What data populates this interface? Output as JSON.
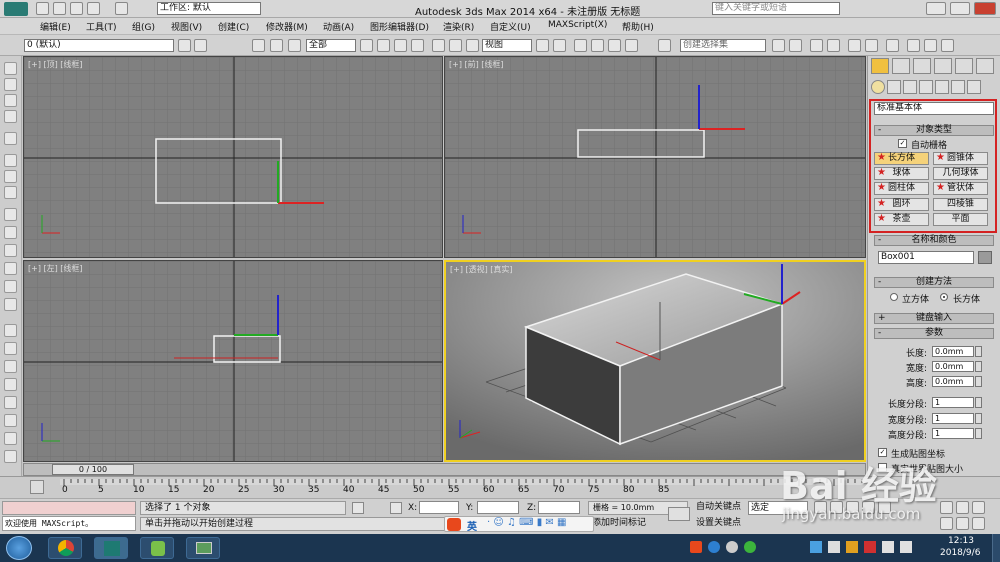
{
  "window": {
    "title": "Autodesk 3ds Max  2014 x64  - 未注册版   无标题",
    "workspace": "工作区: 默认",
    "search_placeholder": "键入关键字或短语"
  },
  "menu": [
    "编辑(E)",
    "工具(T)",
    "组(G)",
    "视图(V)",
    "创建(C)",
    "修改器(M)",
    "动画(A)",
    "图形编辑器(D)",
    "渲染(R)",
    "自定义(U)",
    "MAXScript(X)",
    "帮助(H)"
  ],
  "toolbar": {
    "layer": "0 (默认)",
    "selection_filter": "全部",
    "ref_coord": "视图",
    "named_selection": "创建选择集"
  },
  "viewports": {
    "top": "[+] [顶] [线框]",
    "front": "[+] [前] [线框]",
    "left": "[+] [左] [线框]",
    "perspective": "[+] [透视] [真实]"
  },
  "command_panel": {
    "category": "标准基本体",
    "object_type_header": "对象类型",
    "autogrid": "自动栅格",
    "buttons": [
      "长方体",
      "圆锥体",
      "球体",
      "几何球体",
      "圆柱体",
      "管状体",
      "圆环",
      "四棱锥",
      "茶壶",
      "平面"
    ],
    "name_color_header": "名称和颜色",
    "object_name": "Box001",
    "creation_method_header": "创建方法",
    "radio_cube": "立方体",
    "radio_box": "长方体",
    "keyboard_entry_header": "键盘输入",
    "params_header": "参数",
    "params": [
      {
        "label": "长度:",
        "value": "0.0mm"
      },
      {
        "label": "宽度:",
        "value": "0.0mm"
      },
      {
        "label": "高度:",
        "value": "0.0mm"
      }
    ],
    "segments": [
      {
        "label": "长度分段:",
        "value": "1"
      },
      {
        "label": "宽度分段:",
        "value": "1"
      },
      {
        "label": "高度分段:",
        "value": "1"
      }
    ],
    "gen_map_coords": "生成贴图坐标",
    "real_world_map": "真实世界贴图大小"
  },
  "timeline": {
    "frame_counter": "0 / 100",
    "ticks": [
      "0",
      "5",
      "10",
      "15",
      "20",
      "25",
      "30",
      "35",
      "40",
      "45",
      "50",
      "55",
      "60",
      "65",
      "70",
      "75",
      "80",
      "85"
    ]
  },
  "status": {
    "maxscript_welcome": "欢迎使用 MAXScript。",
    "selected": "选择了 1 个对象",
    "prompt": "单击并拖动以开始创建过程",
    "x_label": "X:",
    "y_label": "Y:",
    "z_label": "Z:",
    "grid": "栅格 = 10.0mm",
    "add_time_tag": "添加时间标记",
    "auto_key": "自动关键点",
    "set_key": "设置关键点",
    "selected_dropdown": "选定",
    "ime": "英"
  },
  "taskbar": {
    "time": "12:13",
    "date": "2018/9/6"
  },
  "watermark": "jingyan.baidu.com",
  "colors": {
    "highlight_red": "#d42222",
    "active_viewport": "#f0d020",
    "viewport_bg": "#808080"
  }
}
